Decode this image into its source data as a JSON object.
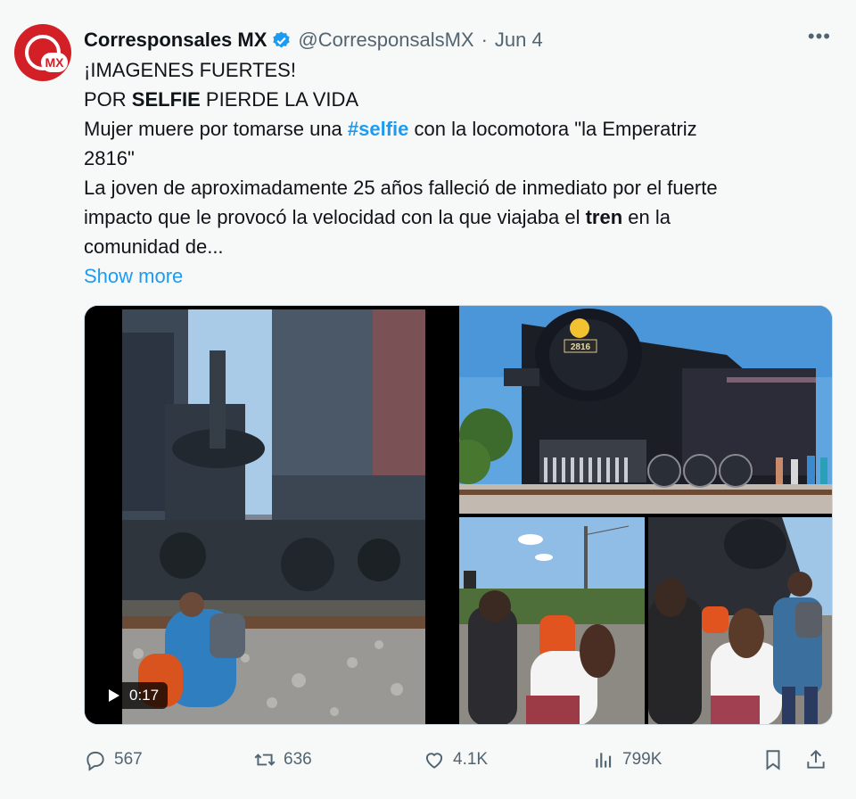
{
  "tweet": {
    "author_name": "Corresponsales MX",
    "handle": "@CorresponsalsMX",
    "separator": "·",
    "date": "Jun 4",
    "more": "•••",
    "avatar_text": "MX",
    "line1": "¡IMAGENES FUERTES!",
    "line2_a": "POR ",
    "line2_b": "SELFIE",
    "line2_c": " PIERDE LA VIDA",
    "line3_a": "Mujer muere por tomarse una ",
    "line3_hashtag": "#selfie",
    "line3_b": " con la locomotora \"la Emperatriz",
    "line4": "2816\"",
    "line5": "La joven de aproximadamente 25 años falleció de inmediato por el fuerte",
    "line6_a": "impacto que le provocó la velocidad con la que viajaba el ",
    "line6_b": "tren",
    "line6_c": " en la",
    "line7": "comunidad de...",
    "show_more": "Show more",
    "video_duration": "0:17",
    "locomotive_number": "2816"
  },
  "actions": {
    "replies": "567",
    "reposts": "636",
    "likes": "4.1K",
    "views": "799K"
  },
  "colors": {
    "accent": "#1d9bf0",
    "brand": "#d32027",
    "muted": "#536471",
    "background": "#f7f9f9"
  },
  "icons": [
    "verified-icon",
    "more-icon",
    "reply-icon",
    "repost-icon",
    "like-icon",
    "views-icon",
    "bookmark-icon",
    "share-icon",
    "play-icon"
  ]
}
